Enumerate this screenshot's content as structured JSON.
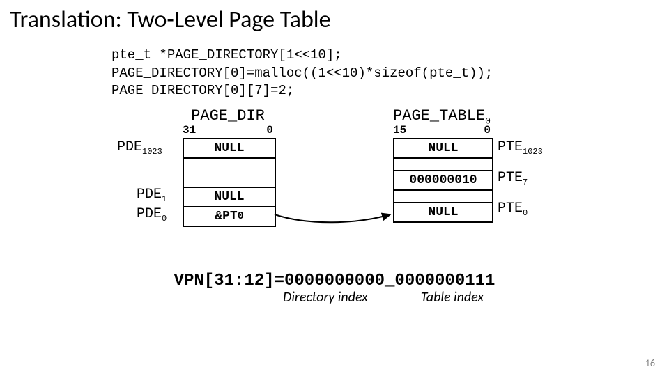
{
  "title": "Translation: Two-Level Page Table",
  "code": {
    "l1": "pte_t *PAGE_DIRECTORY[1<<10];",
    "l2": "PAGE_DIRECTORY[0]=malloc((1<<10)*sizeof(pte_t));",
    "l3": "PAGE_DIRECTORY[0][7]=2;"
  },
  "dir": {
    "title": "PAGE_DIR",
    "hi": "31",
    "lo": "0",
    "row_labels": {
      "top": "PDE",
      "top_sub": "1023",
      "r1": "PDE",
      "r1_sub": "1",
      "r0": "PDE",
      "r0_sub": "0"
    },
    "cells": {
      "top": "NULL",
      "mid": "",
      "r1": "NULL",
      "r0": "&PT",
      "r0_sub": "0"
    }
  },
  "pt": {
    "title": "PAGE_TABLE",
    "title_sub": "0",
    "hi": "15",
    "lo": "0",
    "row_labels": {
      "top": "PTE",
      "top_sub": "1023",
      "r7": "PTE",
      "r7_sub": "7",
      "r0": "PTE",
      "r0_sub": "0"
    },
    "cells": {
      "top": "NULL",
      "gap1": "",
      "r7": "000000010",
      "gap2": "",
      "r0": "NULL"
    }
  },
  "vpn": {
    "prefix": "VPN[31:12]=",
    "dir_bits": "0000000000",
    "sep": "_",
    "tbl_bits": "0000000111",
    "dir_label": "Directory index",
    "tbl_label": "Table index"
  },
  "page_num": "16"
}
